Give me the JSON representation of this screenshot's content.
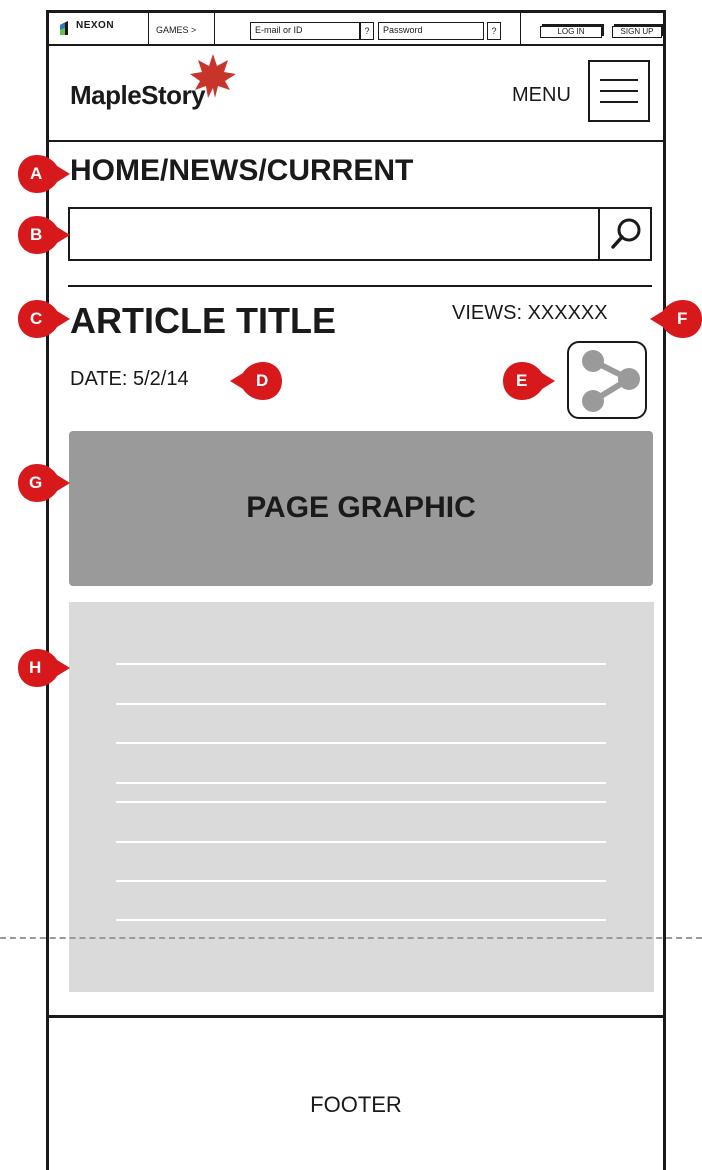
{
  "topbar": {
    "brand": "NEXON",
    "games_label": "GAMES >",
    "email_placeholder": "E-mail or ID",
    "email_help": "?",
    "password_placeholder": "Password",
    "password_help": "?",
    "login_label": "LOG IN",
    "signup_label": "SIGN UP"
  },
  "header": {
    "logo_text": "MapleStory",
    "menu_label": "MENU"
  },
  "breadcrumb": "HOME/NEWS/CURRENT",
  "search": {
    "placeholder": ""
  },
  "article": {
    "title": "ARTICLE TITLE",
    "views": "VIEWS: XXXXXX",
    "date": "DATE: 5/2/14",
    "graphic_label": "PAGE GRAPHIC"
  },
  "footer": {
    "label": "FOOTER"
  },
  "callouts": {
    "a": "A",
    "b": "B",
    "c": "C",
    "d": "D",
    "e": "E",
    "f": "F",
    "g": "G",
    "h": "H"
  },
  "colors": {
    "callout": "#d8191c",
    "graphic": "#9a9a9a",
    "body_block": "#dadada",
    "share_icon": "#9a9a9a",
    "logo_leaf": "#c8342a"
  },
  "icons": {
    "search": "search-icon",
    "menu": "hamburger-menu-icon",
    "share": "share-icon",
    "brand": "nexon-logo-icon",
    "logo": "maple-leaf-icon"
  }
}
